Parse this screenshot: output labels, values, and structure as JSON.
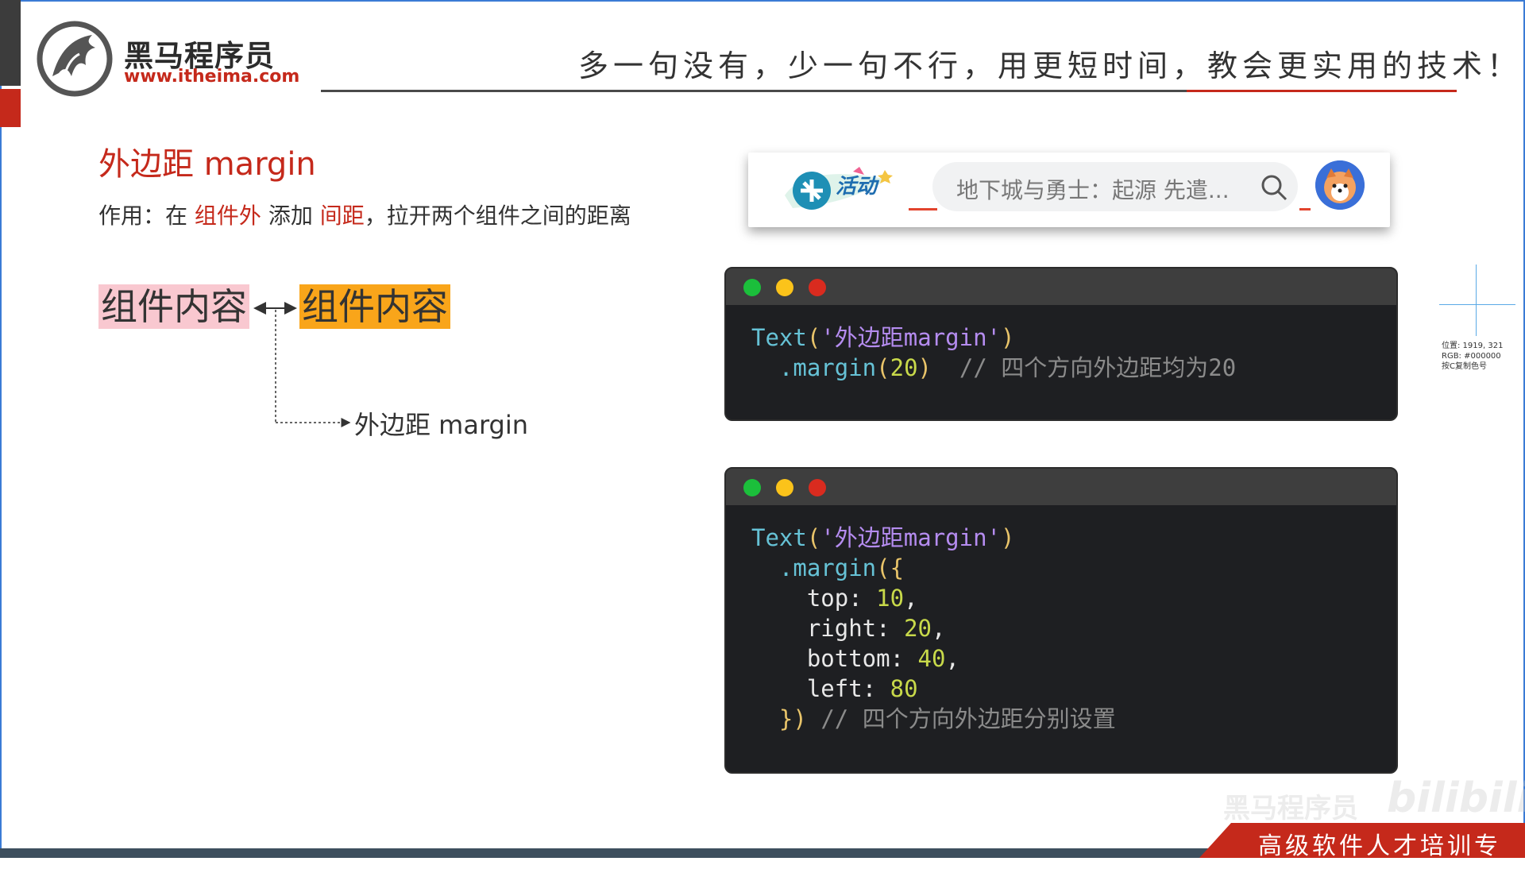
{
  "logo": {
    "name": "黑马程序员",
    "url": "www.itheima.com"
  },
  "slogan": "多一句没有，少一句不行，用更短时间，教会更实用的技术！",
  "heading": "外边距 margin",
  "description": {
    "prefix": "作用：在 ",
    "red1": "组件外",
    "mid": " 添加 ",
    "red2": "间距",
    "suffix": "，拉开两个组件之间的距离"
  },
  "diagram": {
    "box1": "组件内容",
    "box2": "组件内容",
    "label": "外边距 margin"
  },
  "topbar": {
    "activity": "活动",
    "search_text": "地下城与勇士：起源 先遣..."
  },
  "code1": {
    "line1_fn": "Text",
    "line1_str": "'外边距margin'",
    "line2_method": ".margin",
    "line2_arg": "20",
    "line2_comment": "// 四个方向外边距均为20"
  },
  "code2": {
    "line1_fn": "Text",
    "line1_str": "'外边距margin'",
    "line2_method": ".margin",
    "top_key": "top",
    "top_val": "10",
    "right_key": "right",
    "right_val": "20",
    "bottom_key": "bottom",
    "bottom_val": "40",
    "left_key": "left",
    "left_val": "80",
    "comment": "// 四个方向外边距分别设置"
  },
  "crosshair": {
    "position": "位置: 1919, 321",
    "rgb": "RGB: #000000",
    "hint": "按C复制色号"
  },
  "footer": {
    "tagline": "高级软件人才培训专家",
    "watermark1": "黑马程序员",
    "watermark2": "bilibili"
  },
  "colors": {
    "brand_red": "#c5291b",
    "code_bg": "#1e1f22",
    "box1_bg": "#f9c8d0",
    "box2_bg": "#f9a51a"
  }
}
